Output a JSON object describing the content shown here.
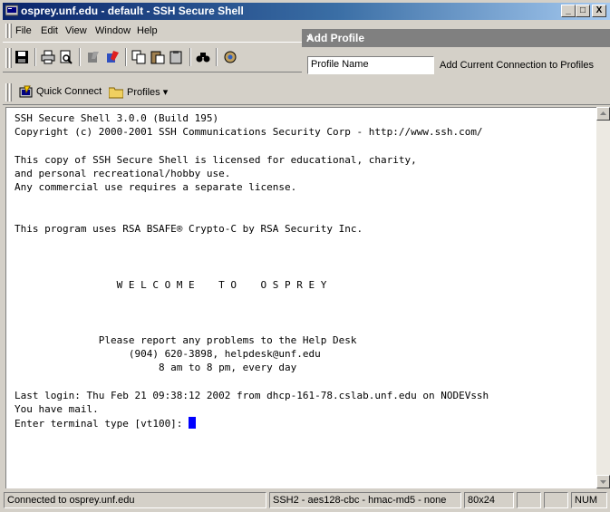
{
  "window": {
    "title": "osprey.unf.edu - default - SSH Secure Shell",
    "minimize": "_",
    "maximize": "□",
    "close": "X"
  },
  "menu": [
    "File",
    "Edit",
    "View",
    "Window",
    "Help"
  ],
  "toolbar": {
    "icons": [
      "save-icon",
      "print-icon",
      "print-preview-icon",
      "edit-icon",
      "paste-colored-icon",
      "copy-icon",
      "paste-icon",
      "paste-disabled-icon",
      "find-icon",
      "settings-icon"
    ]
  },
  "popup": {
    "title": "Add Profile",
    "close": "×",
    "input_value": "Profile Name",
    "add_current": "Add Current Connection to Profiles"
  },
  "toolbar2": {
    "quick_connect": "Quick Connect",
    "profiles": "Profiles ▾"
  },
  "terminal": {
    "lines": [
      "SSH Secure Shell 3.0.0 (Build 195)",
      "Copyright (c) 2000-2001 SSH Communications Security Corp - http://www.ssh.com/",
      "",
      "This copy of SSH Secure Shell is licensed for educational, charity,",
      "and personal recreational/hobby use.",
      "Any commercial use requires a separate license.",
      "",
      "",
      "This program uses RSA BSAFE® Crypto-C by RSA Security Inc.",
      "",
      "",
      "",
      "                 W E L C O M E    T O    O S P R E Y",
      "",
      "",
      "",
      "              Please report any problems to the Help Desk",
      "                   (904) 620-3898, helpdesk@unf.edu",
      "                        8 am to 8 pm, every day",
      "",
      "Last login: Thu Feb 21 09:38:12 2002 from dhcp-161-78.cslab.unf.edu on NODEVssh",
      "You have mail.",
      "Enter terminal type [vt100]: "
    ]
  },
  "status": {
    "connection": "Connected to osprey.unf.edu",
    "cipher": "SSH2 - aes128-cbc - hmac-md5 - none",
    "size": "80x24",
    "num": "NUM"
  }
}
